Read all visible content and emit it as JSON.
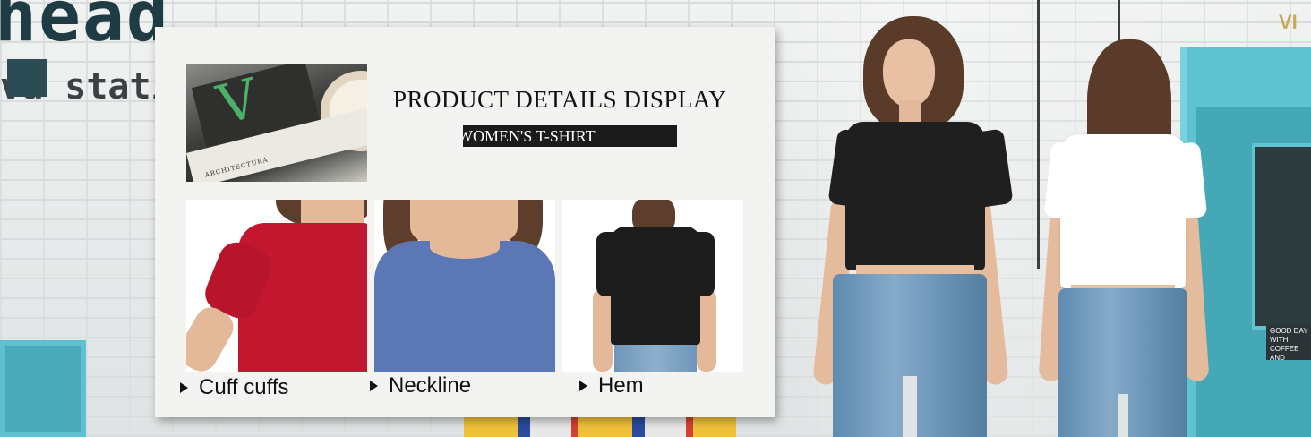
{
  "background": {
    "sign_text": "head",
    "sign_subtext": "va stati",
    "top_right_letters": "VI",
    "door_sign": "GOOD DAY WITH COFFEE AND"
  },
  "card": {
    "title": "PRODUCT DETAILS DISPLAY",
    "subtitle": "WOMEN'S T-SHIRT",
    "magazine_text": "ARCHITECTURA",
    "details": [
      {
        "label": "Cuff cuffs",
        "shirt_color": "#c3172f"
      },
      {
        "label": "Neckline",
        "shirt_color": "#5b77b6"
      },
      {
        "label": "Hem",
        "shirt_color": "#1d1d1d"
      }
    ]
  },
  "models": {
    "front_shirt_color": "#1f1f1f",
    "back_shirt_color": "#ffffff",
    "jeans_color": "#6f97bb"
  }
}
